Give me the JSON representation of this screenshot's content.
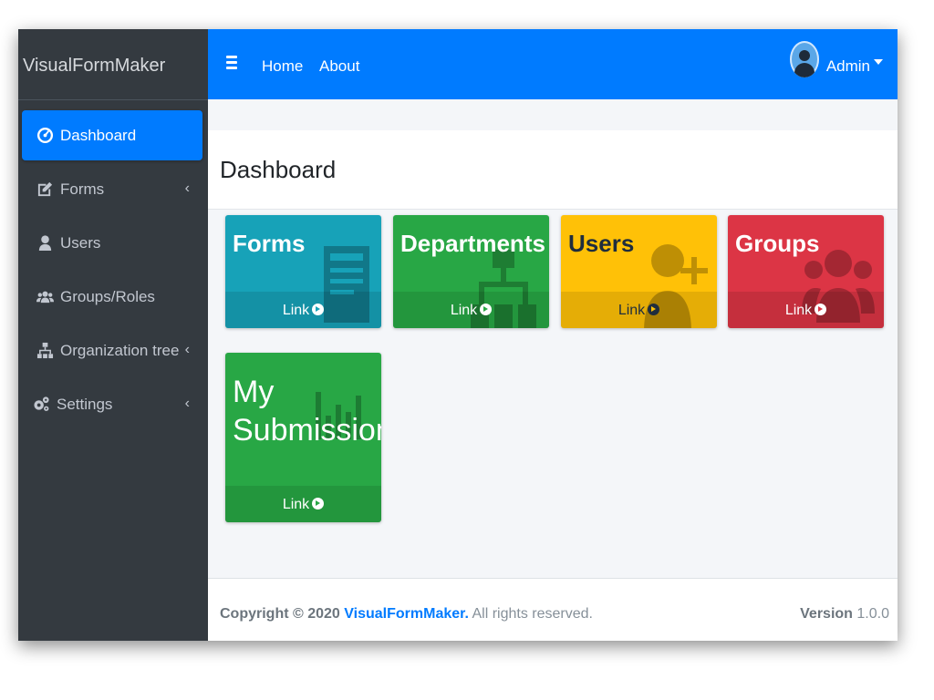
{
  "app": {
    "brand": "VisualFormMaker"
  },
  "sidebar": {
    "items": [
      {
        "label": "Dashboard",
        "icon": "dashboard-icon",
        "active": true,
        "has_children": false
      },
      {
        "label": "Forms",
        "icon": "edit-icon",
        "active": false,
        "has_children": true
      },
      {
        "label": "Users",
        "icon": "user-icon",
        "active": false,
        "has_children": false
      },
      {
        "label": "Groups/Roles",
        "icon": "users-icon",
        "active": false,
        "has_children": false
      },
      {
        "label": "Organization tree",
        "icon": "sitemap-icon",
        "active": false,
        "has_children": true
      },
      {
        "label": "Settings",
        "icon": "cogs-icon",
        "active": false,
        "has_children": true
      }
    ],
    "chevron": "‹"
  },
  "topbar": {
    "menu_icon": "hamburger-icon",
    "links": [
      "Home",
      "About"
    ],
    "user_name": "Admin"
  },
  "main": {
    "title": "Dashboard",
    "cards": [
      {
        "title": "Forms",
        "link": "Link",
        "color": "#17a2b8",
        "icon": "form-icon"
      },
      {
        "title": "Departments",
        "link": "Link",
        "color": "#28a745",
        "icon": "sitemap-icon"
      },
      {
        "title": "Users",
        "link": "Link",
        "color": "#ffc107",
        "icon": "user-plus-icon"
      },
      {
        "title": "Groups",
        "link": "Link",
        "color": "#dc3545",
        "icon": "users-icon"
      },
      {
        "title_line1": "My",
        "title_line2": "Submissions",
        "link": "Link",
        "color": "#28a745",
        "icon": "bar-chart-icon"
      }
    ]
  },
  "footer": {
    "copyright_prefix": "Copyright © 2020",
    "brand_link": "VisualFormMaker.",
    "rights": "All rights reserved.",
    "version_label": "Version",
    "version_value": "1.0.0"
  },
  "colors": {
    "primary": "#007bff",
    "sidebar_bg": "#343a40"
  }
}
